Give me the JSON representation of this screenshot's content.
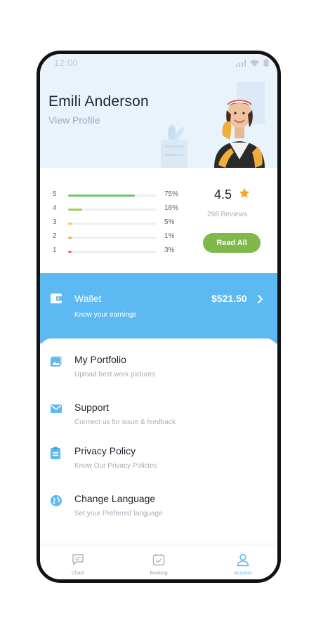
{
  "status_bar": {
    "time": "12:00"
  },
  "profile": {
    "name": "Emili Anderson",
    "link": "View Profile"
  },
  "ratings": {
    "rows": [
      {
        "star": "5",
        "percent_label": "75%",
        "fill": 0.75,
        "color": "#6cc76e"
      },
      {
        "star": "4",
        "percent_label": "16%",
        "fill": 0.16,
        "color": "#9bd15a"
      },
      {
        "star": "3",
        "percent_label": "5%",
        "fill": 0.05,
        "color": "#f2cf3b"
      },
      {
        "star": "2",
        "percent_label": "1%",
        "fill": 0.01,
        "color": "#f3a63b"
      },
      {
        "star": "1",
        "percent_label": "3%",
        "fill": 0.03,
        "color": "#f0725a"
      }
    ],
    "score": "4.5",
    "reviews": "298 Reviews",
    "read_all": "Read All"
  },
  "wallet": {
    "title": "Wallet",
    "subtitle": "Know your earnings",
    "amount": "$521.50"
  },
  "menu": [
    {
      "title": "My Portfolio",
      "subtitle": "Upload best work pictures",
      "icon": "image-icon"
    },
    {
      "title": "Support",
      "subtitle": "Connect us for issue & feedback",
      "icon": "mail-icon"
    },
    {
      "title": "Privacy Policy",
      "subtitle": "Know Our Privacy Policies",
      "icon": "clipboard-icon"
    },
    {
      "title": "Change Language",
      "subtitle": "Set your Preferred language",
      "icon": "globe-icon"
    }
  ],
  "bottom_nav": [
    {
      "label": "Chats",
      "icon": "chat-icon",
      "active": false
    },
    {
      "label": "Booking",
      "icon": "calendar-check-icon",
      "active": false
    },
    {
      "label": "Account",
      "icon": "user-icon",
      "active": true
    }
  ],
  "colors": {
    "accent_blue": "#5cb9f2",
    "accent_green": "#7fb84b",
    "star": "#f3a928",
    "header_bg": "#e9f3fb"
  }
}
